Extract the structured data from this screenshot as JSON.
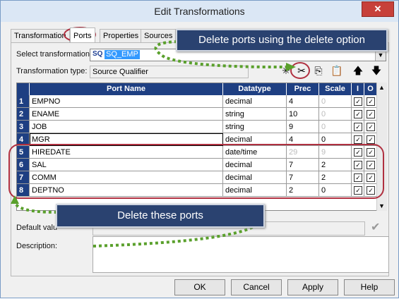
{
  "window": {
    "title": "Edit Transformations",
    "close_glyph": "✕"
  },
  "tabs": [
    "Transformation",
    "Ports",
    "Properties",
    "Sources"
  ],
  "select_transformation": {
    "label": "Select transformation:",
    "tag": "SQ",
    "value": "SQ_EMP"
  },
  "transformation_type": {
    "label": "Transformation type:",
    "value": "Source Qualifier"
  },
  "toolbar": [
    "new-icon",
    "cut-icon",
    "copy-icon",
    "paste-icon",
    "move-up-icon",
    "move-down-icon"
  ],
  "grid": {
    "headers": [
      "Port Name",
      "Datatype",
      "Prec",
      "Scale",
      "I",
      "O"
    ],
    "rows": [
      {
        "num": "1",
        "name": "EMPNO",
        "type": "decimal",
        "prec": "4",
        "scale": "0",
        "scale_dim": true,
        "prec_dim": false
      },
      {
        "num": "2",
        "name": "ENAME",
        "type": "string",
        "prec": "10",
        "scale": "0",
        "scale_dim": true,
        "prec_dim": false
      },
      {
        "num": "3",
        "name": "JOB",
        "type": "string",
        "prec": "9",
        "scale": "0",
        "scale_dim": true,
        "prec_dim": false
      },
      {
        "num": "4",
        "name": "MGR",
        "type": "decimal",
        "prec": "4",
        "scale": "0",
        "scale_dim": false,
        "prec_dim": false
      },
      {
        "num": "5",
        "name": "HIREDATE",
        "type": "date/time",
        "prec": "29",
        "scale": "9",
        "scale_dim": true,
        "prec_dim": true
      },
      {
        "num": "6",
        "name": "SAL",
        "type": "decimal",
        "prec": "7",
        "scale": "2",
        "scale_dim": false,
        "prec_dim": false
      },
      {
        "num": "7",
        "name": "COMM",
        "type": "decimal",
        "prec": "7",
        "scale": "2",
        "scale_dim": false,
        "prec_dim": false
      },
      {
        "num": "8",
        "name": "DEPTNO",
        "type": "decimal",
        "prec": "2",
        "scale": "0",
        "scale_dim": false,
        "prec_dim": false
      }
    ]
  },
  "callouts": {
    "top": "Delete ports using the delete option",
    "bottom": "Delete these ports"
  },
  "default_value": {
    "label": "Default valu"
  },
  "description": {
    "label": "Description:"
  },
  "buttons": {
    "ok": "OK",
    "cancel": "Cancel",
    "apply": "Apply",
    "help": "Help"
  },
  "colors": {
    "header_blue": "#1e3f82",
    "annotation_red": "#b03040",
    "arrow_green": "#5aa02c",
    "callout_navy": "#2a4270"
  }
}
